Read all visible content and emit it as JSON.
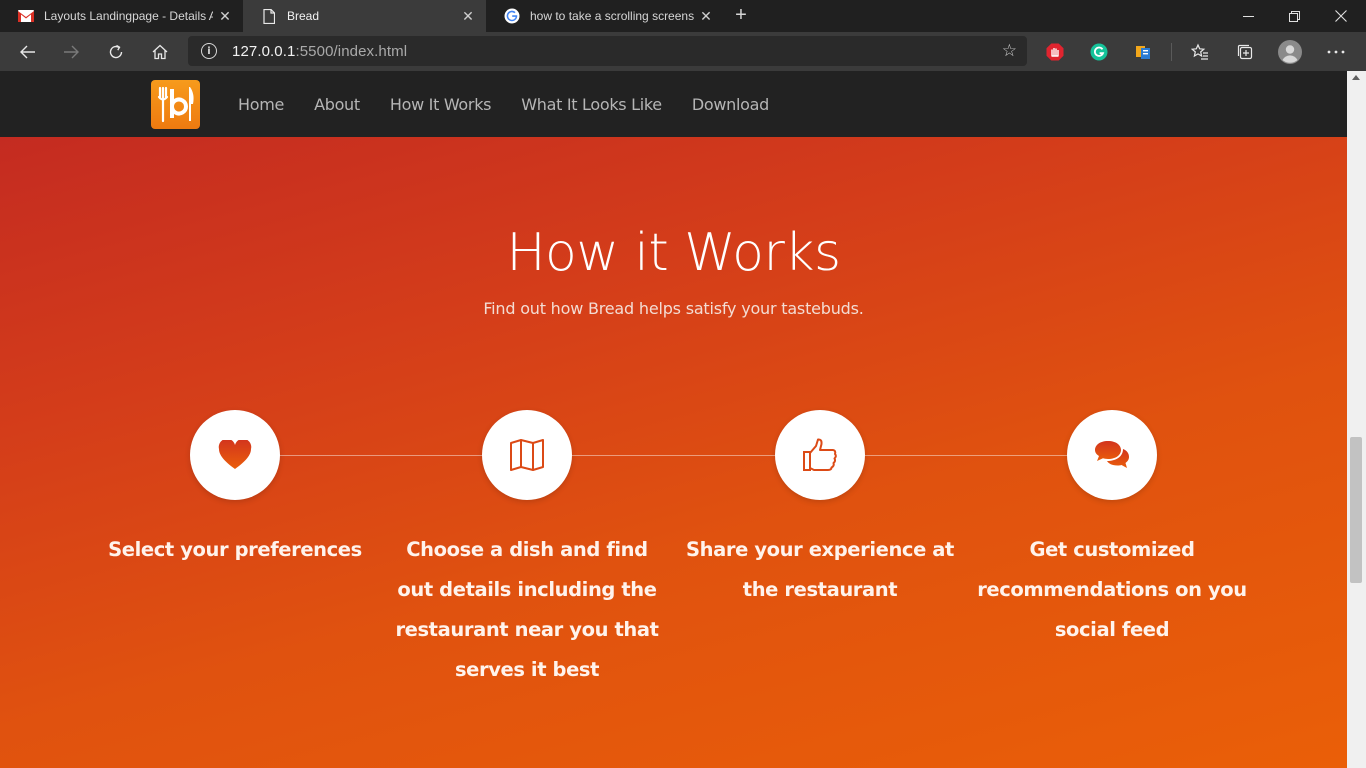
{
  "browser": {
    "tabs": [
      {
        "title": "Layouts Landingpage - Details Ar",
        "icon": "gmail-icon",
        "active": false
      },
      {
        "title": "Bread",
        "icon": "page-icon",
        "active": true
      },
      {
        "title": "how to take a scrolling screensho",
        "icon": "google-icon",
        "active": false
      }
    ],
    "url_host": "127.0.0.1",
    "url_rest": ":5500/index.html"
  },
  "site": {
    "nav": [
      "Home",
      "About",
      "How It Works",
      "What It Looks Like",
      "Download"
    ]
  },
  "hero": {
    "title": "How it Works",
    "subtitle": "Find out how Bread helps satisfy your tastebuds.",
    "steps": [
      {
        "icon": "heart-icon",
        "text": "Select your preferences"
      },
      {
        "icon": "map-icon",
        "text": "Choose a dish and find out details including the restaurant near you that serves it best"
      },
      {
        "icon": "thumbs-up-icon",
        "text": "Share your experience at the restaurant"
      },
      {
        "icon": "chat-bubbles-icon",
        "text": "Get customized recommendations on you social feed"
      }
    ]
  },
  "colors": {
    "accent": "#e2531a",
    "nav_bg": "#222222",
    "logo": "#f28a16"
  }
}
